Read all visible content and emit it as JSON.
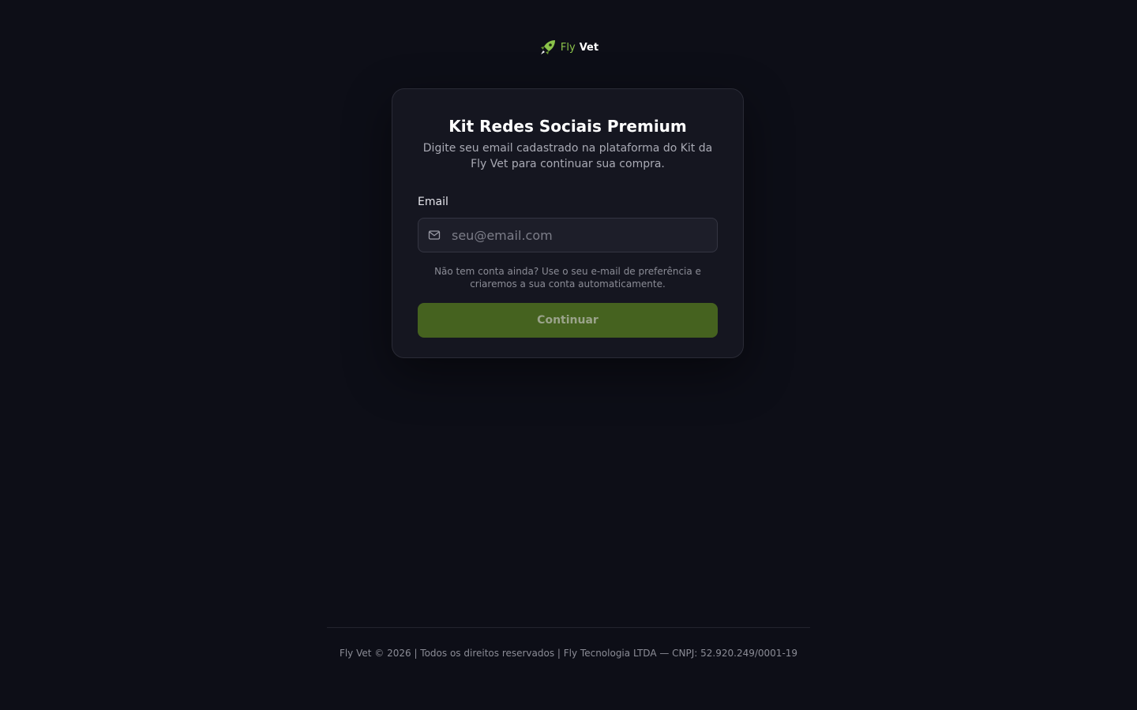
{
  "brand": {
    "fly": "Fly",
    "vet": "Vet",
    "logo_icon": "rocket-icon",
    "accent_color": "#8bc34a"
  },
  "card": {
    "title": "Kit Redes Sociais Premium",
    "subtitle": "Digite seu email cadastrado na plataforma do Kit da Fly Vet para continuar sua compra.",
    "email_label": "Email",
    "email_value": "",
    "email_placeholder": "seu@email.com",
    "email_icon": "mail-icon",
    "hint": "Não tem conta ainda? Use o seu e-mail de preferência e criaremos a sua conta automaticamente.",
    "continue_label": "Continuar",
    "button_color": "#45621f"
  },
  "footer": {
    "text": "Fly Vet © 2026 | Todos os direitos reservados | Fly Tecnologia LTDA — CNPJ: 52.920.249/0001-19"
  }
}
